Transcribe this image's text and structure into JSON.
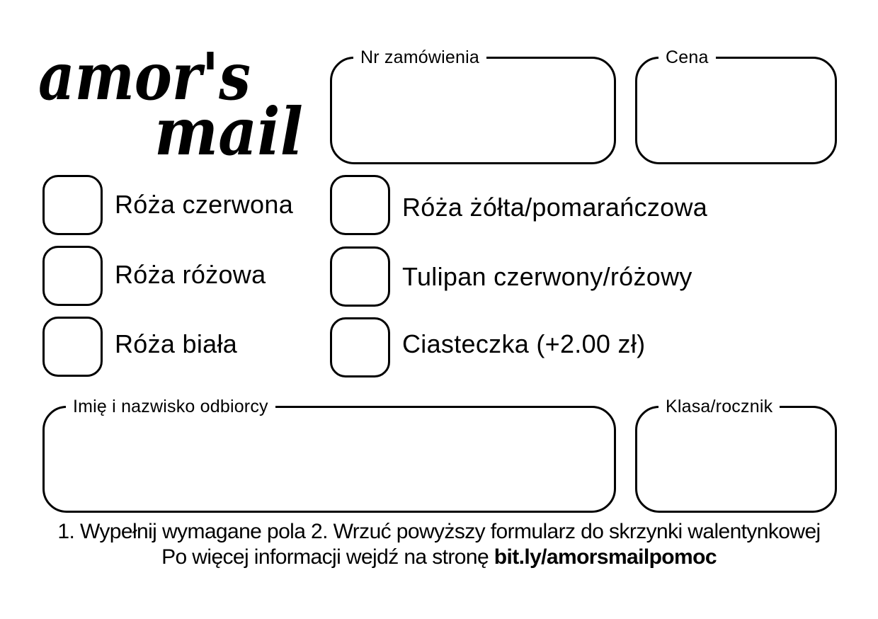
{
  "logo": {
    "line1": "amor's",
    "line2": "mail"
  },
  "fields": {
    "order_number": {
      "label": "Nr zamówienia",
      "value": ""
    },
    "price": {
      "label": "Cena",
      "value": ""
    },
    "recipient_name": {
      "label": "Imię i nazwisko odbiorcy",
      "value": ""
    },
    "class_year": {
      "label": "Klasa/rocznik",
      "value": ""
    }
  },
  "options": [
    {
      "label": "Róża czerwona",
      "checked": false
    },
    {
      "label": "Róża różowa",
      "checked": false
    },
    {
      "label": "Róża biała",
      "checked": false
    },
    {
      "label": "Róża żółta/pomarańczowa",
      "checked": false
    },
    {
      "label": "Tulipan czerwony/różowy",
      "checked": false
    },
    {
      "label": "Ciasteczka (+2.00 zł)",
      "checked": false
    }
  ],
  "footer": {
    "instructions": "1. Wypełnij wymagane pola 2. Wrzuć powyższy formularz do skrzynki walentynkowej",
    "info_prefix": "Po więcej informacji wejdź na stronę ",
    "info_link": "bit.ly/amorsmailpomoc"
  }
}
